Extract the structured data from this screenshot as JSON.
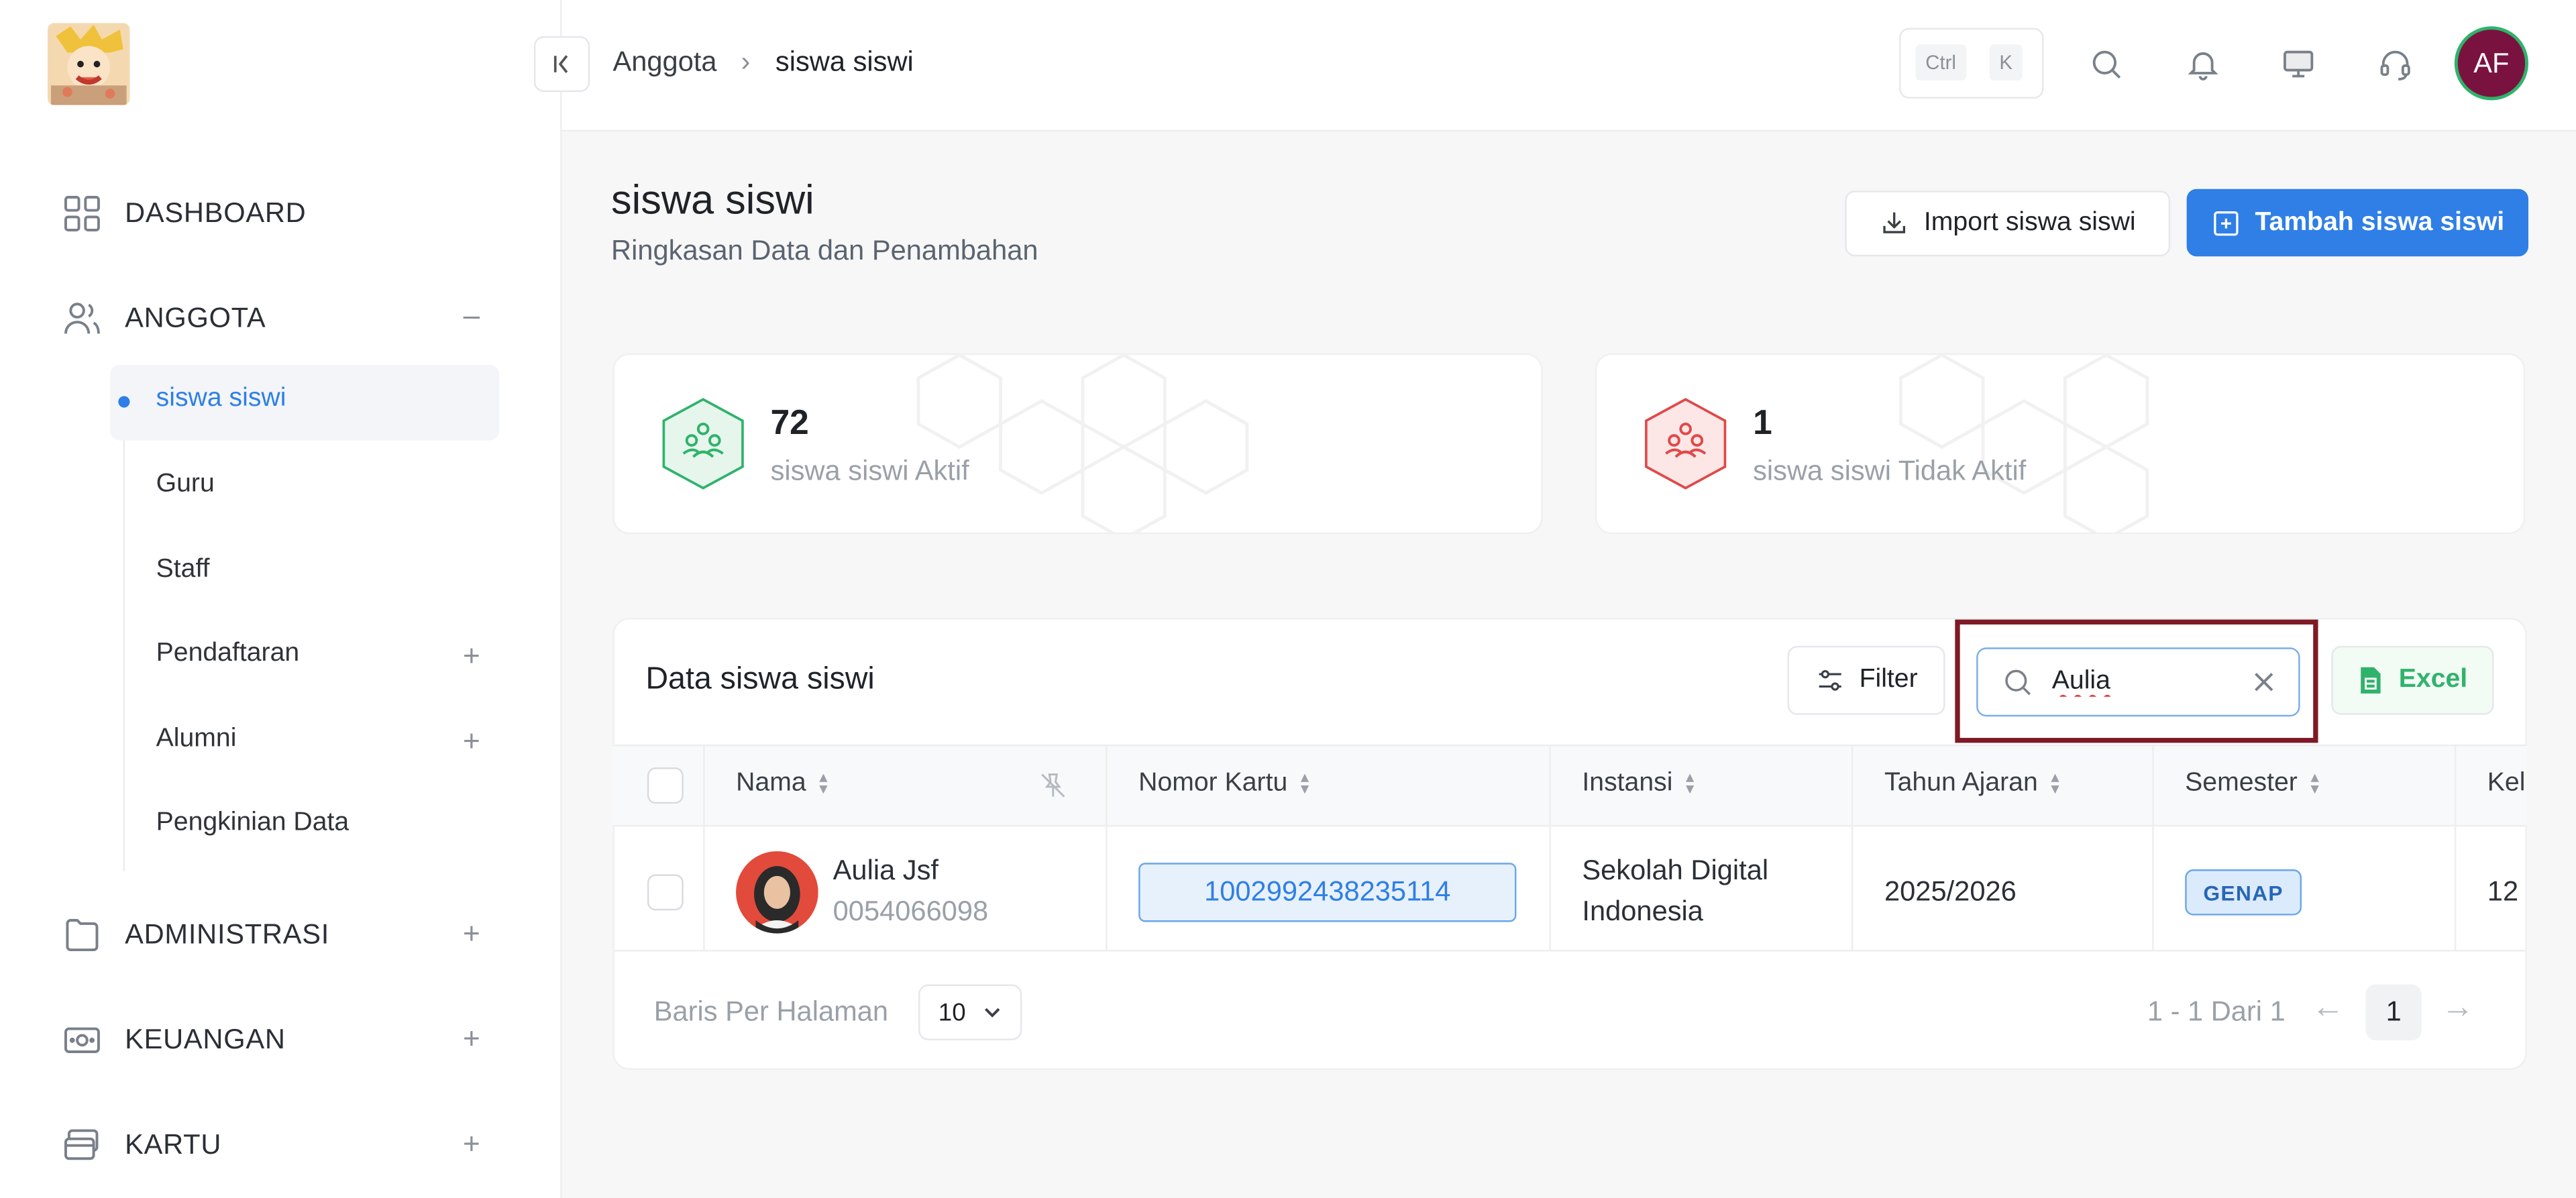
{
  "breadcrumb": {
    "parent": "Anggota",
    "separator": "›",
    "current": "siswa siswi"
  },
  "topbar": {
    "kbd_ctrl": "Ctrl",
    "kbd_k": "K",
    "avatar_initials": "AF"
  },
  "sidebar": {
    "dashboard": "DASHBOARD",
    "anggota": "ANGGOTA",
    "anggota_toggle": "–",
    "sub_items": [
      "siswa siswi",
      "Guru",
      "Staff",
      "Pendaftaran",
      "Alumni",
      "Pengkinian Data"
    ],
    "expand_symbol": "+",
    "administrasi": "ADMINISTRASI",
    "keuangan": "KEUANGAN",
    "kartu": "KARTU"
  },
  "page": {
    "title": "siswa siswi",
    "subtitle": "Ringkasan Data dan Penambahan",
    "import_label": "Import siswa siswi",
    "add_label": "Tambah siswa siswi"
  },
  "stats": {
    "active_count": "72",
    "active_label": "siswa siswi Aktif",
    "inactive_count": "1",
    "inactive_label": "siswa siswi Tidak Aktif",
    "active_color": "#2fb36b",
    "inactive_color": "#e04848"
  },
  "table": {
    "title": "Data siswa siswi",
    "filter_label": "Filter",
    "search_value": "Aulia",
    "excel_label": "Excel",
    "columns": [
      "Nama",
      "Nomor Kartu",
      "Instansi",
      "Tahun Ajaran",
      "Semester",
      "Kel"
    ],
    "rows": [
      {
        "name": "Aulia Jsf",
        "nis": "0054066098",
        "card_number": "1002992438235114",
        "instansi_line1": "Sekolah Digital",
        "instansi_line2": "Indonesia",
        "tahun_ajaran": "2025/2026",
        "semester": "GENAP",
        "kelas": "12"
      }
    ],
    "rows_per_page_label": "Baris Per Halaman",
    "rows_per_page": "10",
    "range_text": "1 - 1 Dari 1",
    "prev_arrow": "←",
    "next_arrow": "→",
    "current_page": "1"
  },
  "colors": {
    "accent": "#2f7fe6",
    "avatar_bg": "#7a1240",
    "highlight_border": "#7e1a25"
  }
}
